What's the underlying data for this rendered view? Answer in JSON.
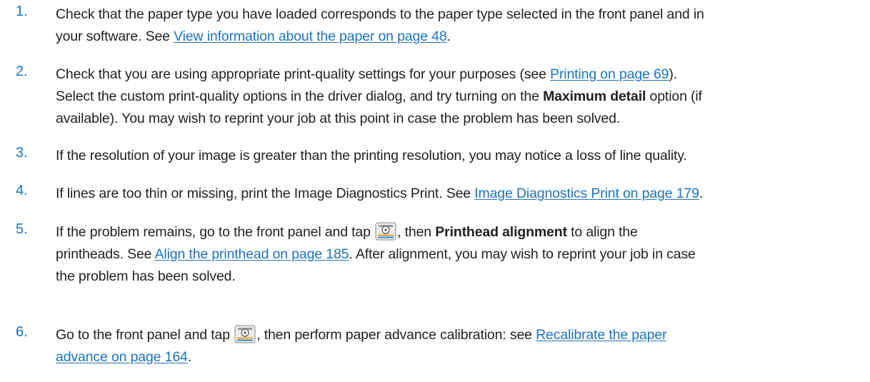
{
  "steps": [
    {
      "number": "1.",
      "line1a": "Check that the paper type you have loaded corresponds to the paper type selected in the front panel and in",
      "line2a": "your software. See ",
      "link": "View information about the paper on page 48",
      "line2b": "."
    },
    {
      "number": "2.",
      "line1a": "Check that you are using appropriate print-quality settings for your purposes (see ",
      "link": "Printing on page 69",
      "line1b": ").",
      "line2a": "Select the custom print-quality options in the driver dialog, and try turning on the ",
      "bold": "Maximum detail",
      "line2b": " option (if",
      "line3": "available). You may wish to reprint your job at this point in case the problem has been solved."
    },
    {
      "number": "3.",
      "line1a": "If the resolution of your image is greater than the printing resolution, you may notice a loss of line quality."
    },
    {
      "number": "4.",
      "line1a": "If lines are too thin or missing, print the Image Diagnostics Print. See ",
      "link": "Image Diagnostics Print on page 179",
      "line1b": "."
    },
    {
      "number": "5.",
      "line1a": "If the problem remains, go to the front panel and tap ",
      "line1b": ", then ",
      "bold": "Printhead alignment",
      "line1c": " to align the",
      "line2a": "printheads. See ",
      "link": "Align the printhead on page 185",
      "line2b": ". After alignment, you may wish to reprint your job in case",
      "line3": "the problem has been solved.",
      "icon": "image-quality-maintenance-icon"
    },
    {
      "number": "6.",
      "line1a": "Go to the front panel and tap ",
      "line1b": ", then perform paper advance calibration: see ",
      "link_a": "Recalibrate the paper",
      "link_b": "advance on page 164",
      "line2b": ".",
      "icon": "image-quality-maintenance-icon"
    }
  ],
  "colors": {
    "accent": "#1e73be",
    "text": "#231f20"
  }
}
